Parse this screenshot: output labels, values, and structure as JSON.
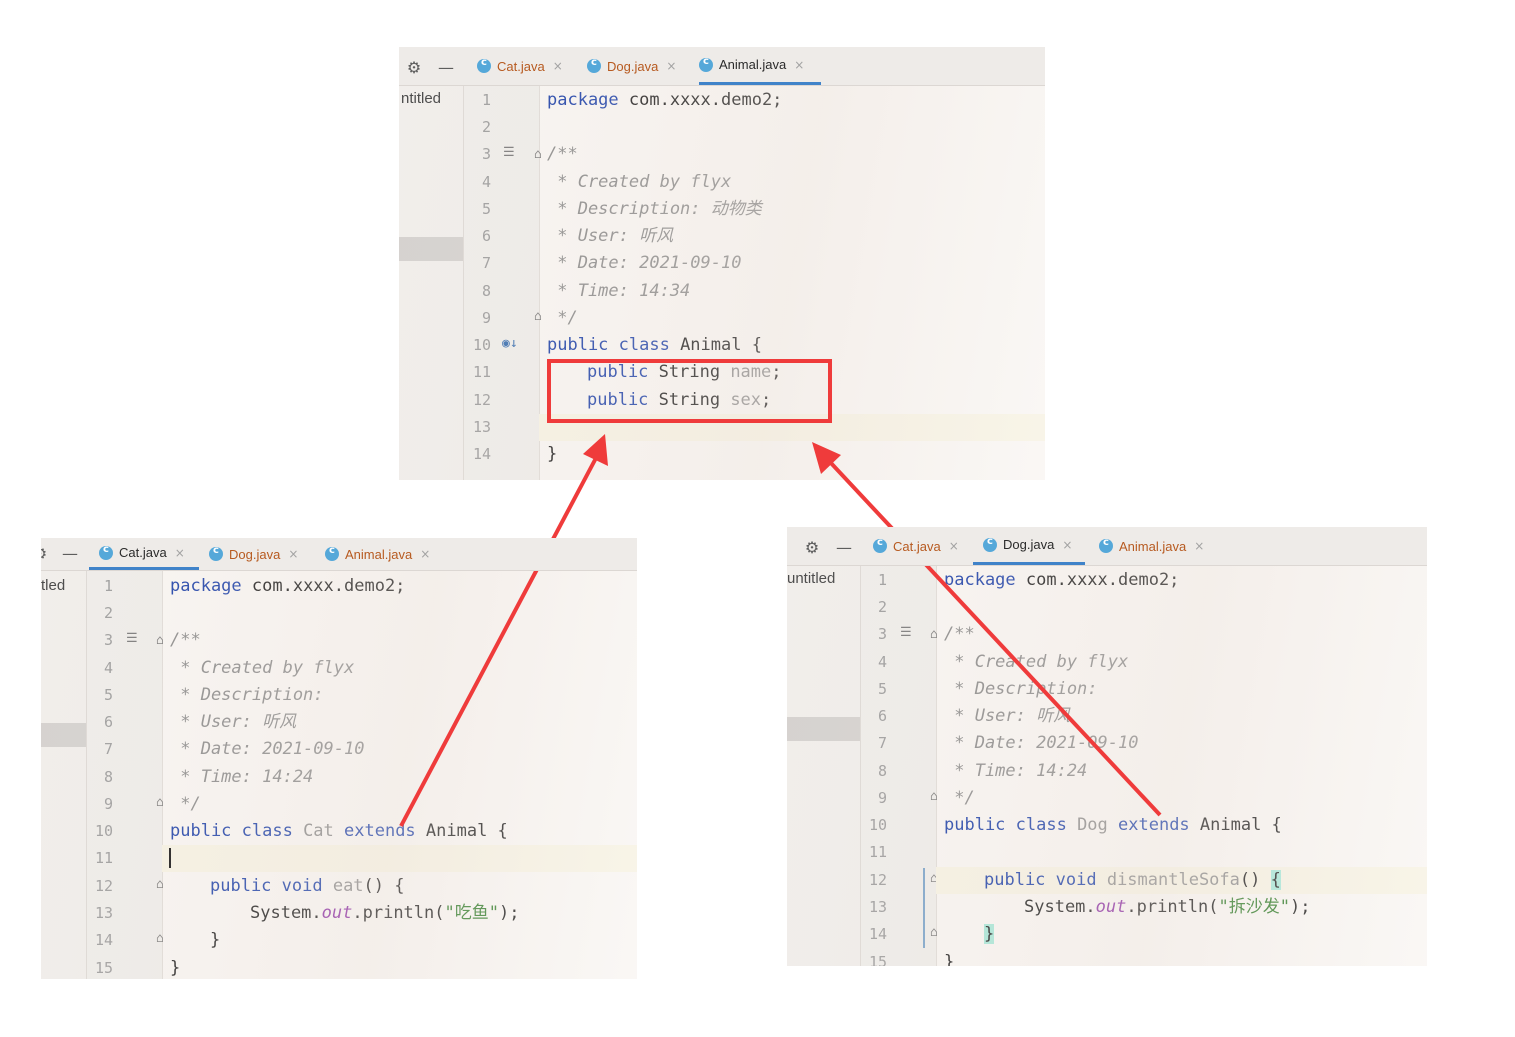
{
  "animal_window": {
    "project_label": "ntitled",
    "tabs": [
      {
        "label": "Cat.java",
        "close": "×"
      },
      {
        "label": "Dog.java",
        "close": "×"
      },
      {
        "label": "Animal.java",
        "close": "×"
      }
    ],
    "line_numbers": [
      "1",
      "2",
      "3",
      "4",
      "5",
      "6",
      "7",
      "8",
      "9",
      "10",
      "11",
      "12",
      "13",
      "14"
    ],
    "code": {
      "l1_kw": "package",
      "l1_rest": " com.xxxx.demo2;",
      "l3": "/**",
      "l4": " * Created by flyx",
      "l5a": " * Description: ",
      "l5b": "动物类",
      "l6a": " * User: ",
      "l6b": "听风",
      "l7": " * Date: 2021-09-10",
      "l8": " * Time: 14:34",
      "l9": " */",
      "l10_kw": "public class",
      "l10_rest": " Animal {",
      "l11_kw": "public",
      "l11_type": " String ",
      "l11_field": "name",
      "l11_end": ";",
      "l12_kw": "public",
      "l12_type": " String ",
      "l12_field": "sex",
      "l12_end": ";",
      "l14": "}"
    }
  },
  "cat_window": {
    "project_label": "tled",
    "tabs": [
      {
        "label": "Cat.java",
        "close": "×"
      },
      {
        "label": "Dog.java",
        "close": "×"
      },
      {
        "label": "Animal.java",
        "close": "×"
      }
    ],
    "line_numbers": [
      "1",
      "2",
      "3",
      "4",
      "5",
      "6",
      "7",
      "8",
      "9",
      "10",
      "11",
      "12",
      "13",
      "14",
      "15"
    ],
    "code": {
      "l1_kw": "package",
      "l1_rest": " com.xxxx.demo2;",
      "l3": "/**",
      "l4": " * Created by flyx",
      "l5": " * Description:",
      "l6a": " * User: ",
      "l6b": "听风",
      "l7": " * Date: 2021-09-10",
      "l8": " * Time: 14:24",
      "l9": " */",
      "l10_kw1": "public class",
      "l10_name": " Cat ",
      "l10_kw2": "extends",
      "l10_rest": " Animal {",
      "l12_kw": "public void",
      "l12_method": " eat",
      "l12_rest": "() {",
      "l13_a": "System.",
      "l13_out": "out",
      "l13_b": ".println(",
      "l13_str": "\"吃鱼\"",
      "l13_c": ");",
      "l14": "}",
      "l15": "}"
    }
  },
  "dog_window": {
    "project_label": "untitled",
    "tabs": [
      {
        "label": "Cat.java",
        "close": "×"
      },
      {
        "label": "Dog.java",
        "close": "×"
      },
      {
        "label": "Animal.java",
        "close": "×"
      }
    ],
    "line_numbers": [
      "1",
      "2",
      "3",
      "4",
      "5",
      "6",
      "7",
      "8",
      "9",
      "10",
      "11",
      "12",
      "13",
      "14",
      "15"
    ],
    "code": {
      "l1_kw": "package",
      "l1_rest": " com.xxxx.demo2;",
      "l3": "/**",
      "l4": " * Created by flyx",
      "l5": " * Description:",
      "l6a": " * User: ",
      "l6b": "听风",
      "l7": " * Date: 2021-09-10",
      "l8": " * Time: 14:24",
      "l9": " */",
      "l10_kw1": "public class",
      "l10_name": " Dog ",
      "l10_kw2": "extends",
      "l10_rest": " Animal {",
      "l12_kw": "public void",
      "l12_method": " dismantleSofa",
      "l12_rest": "() ",
      "l12_brace": "{",
      "l13_a": "System.",
      "l13_out": "out",
      "l13_b": ".println(",
      "l13_str": "\"拆沙发\"",
      "l13_c": ");",
      "l14": "}",
      "l15": "}"
    }
  },
  "colors": {
    "highlight_box": "#ef3b3b",
    "arrow": "#ef3b3b",
    "keyword": "#1b3fa8",
    "comment": "#8a8a8a",
    "string": "#2e7b27",
    "static_field": "#8a2ca3",
    "active_tab_underline": "#4083c9"
  },
  "icons": {
    "settings": "gear-icon",
    "collapse": "minus-icon",
    "java_class": "java-class-icon",
    "close_tab": "close-icon",
    "doc_comment": "doc-comment-icon",
    "fold": "fold-icon",
    "implemented": "implemented-icon"
  }
}
